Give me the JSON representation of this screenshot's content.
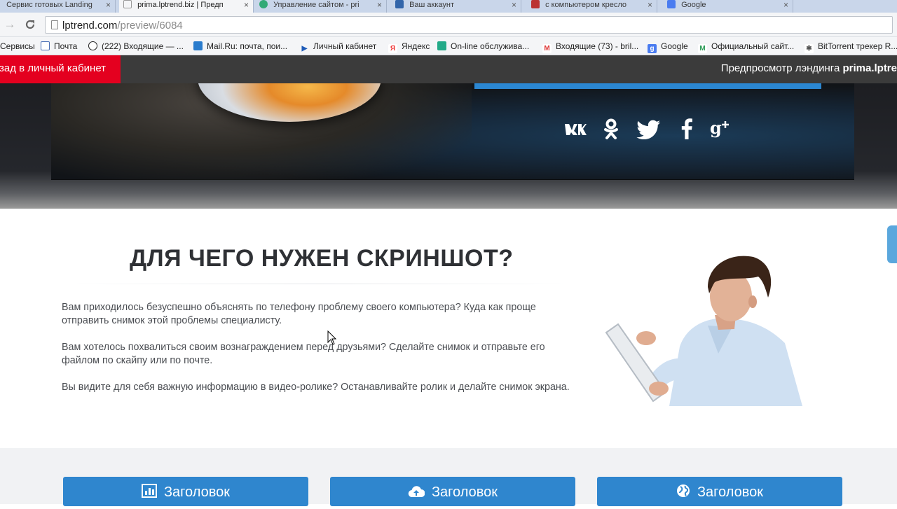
{
  "browser": {
    "tabs": [
      {
        "label": "Сервис готовых Landing",
        "fav_color": "#d44",
        "active": false
      },
      {
        "label": "prima.lptrend.biz | Предп",
        "fav_color": "#999",
        "active": true
      },
      {
        "label": "Управление сайтом - pri",
        "fav_color": "#3a7",
        "active": false
      },
      {
        "label": "Ваш аккаунт",
        "fav_color": "#36a",
        "active": false
      },
      {
        "label": "с компьютером кресло",
        "fav_color": "#b33",
        "active": false
      },
      {
        "label": "Google",
        "fav_color": "#4a7cf0",
        "active": false
      }
    ],
    "close_glyph": "×",
    "url_host": "lptrend.com",
    "url_path": "/preview/6084",
    "bookmarks": [
      {
        "label": "Сервисы",
        "icon": "none",
        "color": "#999"
      },
      {
        "label": "Почта",
        "icon": "mail-icon",
        "color": "#4a6fb5"
      },
      {
        "label": "(222) Входящие — ...",
        "icon": "mailru-icon",
        "color": "#222"
      },
      {
        "label": "Mail.Ru: почта, пои...",
        "icon": "mailru-site-icon",
        "color": "#2a7ccd"
      },
      {
        "label": "Личный кабинет",
        "icon": "play-icon",
        "color": "#1e5bb8"
      },
      {
        "label": "Яндекс",
        "icon": "yandex-icon",
        "color": "#e33"
      },
      {
        "label": "On-line обслужива...",
        "icon": "bank-icon",
        "color": "#2a8"
      },
      {
        "label": "Входящие (73) - bril...",
        "icon": "gmail-icon",
        "color": "#d33"
      },
      {
        "label": "Google",
        "icon": "google-icon",
        "color": "#4a7cf0"
      },
      {
        "label": "Официальный сайт...",
        "icon": "m-icon",
        "color": "#2a9a55"
      },
      {
        "label": "BitTorrent трекер R...",
        "icon": "torrent-icon",
        "color": "#555"
      }
    ]
  },
  "previewbar": {
    "back_label": "зад в личный кабинет",
    "preview_prefix": "Предпросмотр лэндинга ",
    "preview_site": "prima.lptre"
  },
  "hero": {
    "socials": [
      {
        "name": "vk-icon",
        "glyph": "вк"
      },
      {
        "name": "odnoklassniki-icon",
        "glyph": "ок"
      },
      {
        "name": "twitter-icon",
        "glyph": "t"
      },
      {
        "name": "facebook-icon",
        "glyph": "f"
      },
      {
        "name": "google-plus-icon",
        "glyph": "g+"
      }
    ]
  },
  "section": {
    "title": "ДЛЯ ЧЕГО НУЖЕН СКРИНШОТ?",
    "paragraphs": [
      "Вам приходилось безуспешно объяснять по телефону проблему своего компьютера? Куда как проще отправить снимок этой проблемы специалисту.",
      "Вам хотелось похвалиться своим вознаграждением перед друзьями? Сделайте снимок и отправьте его файлом по скайпу или по почте.",
      "Вы видите для себя важную информацию в видео-ролике? Останавливайте ролик и делайте снимок экрана."
    ]
  },
  "cards": [
    {
      "label": "Заголовок",
      "icon": "chart-icon"
    },
    {
      "label": "Заголовок",
      "icon": "cloud-upload-icon"
    },
    {
      "label": "Заголовок",
      "icon": "globe-icon"
    }
  ]
}
